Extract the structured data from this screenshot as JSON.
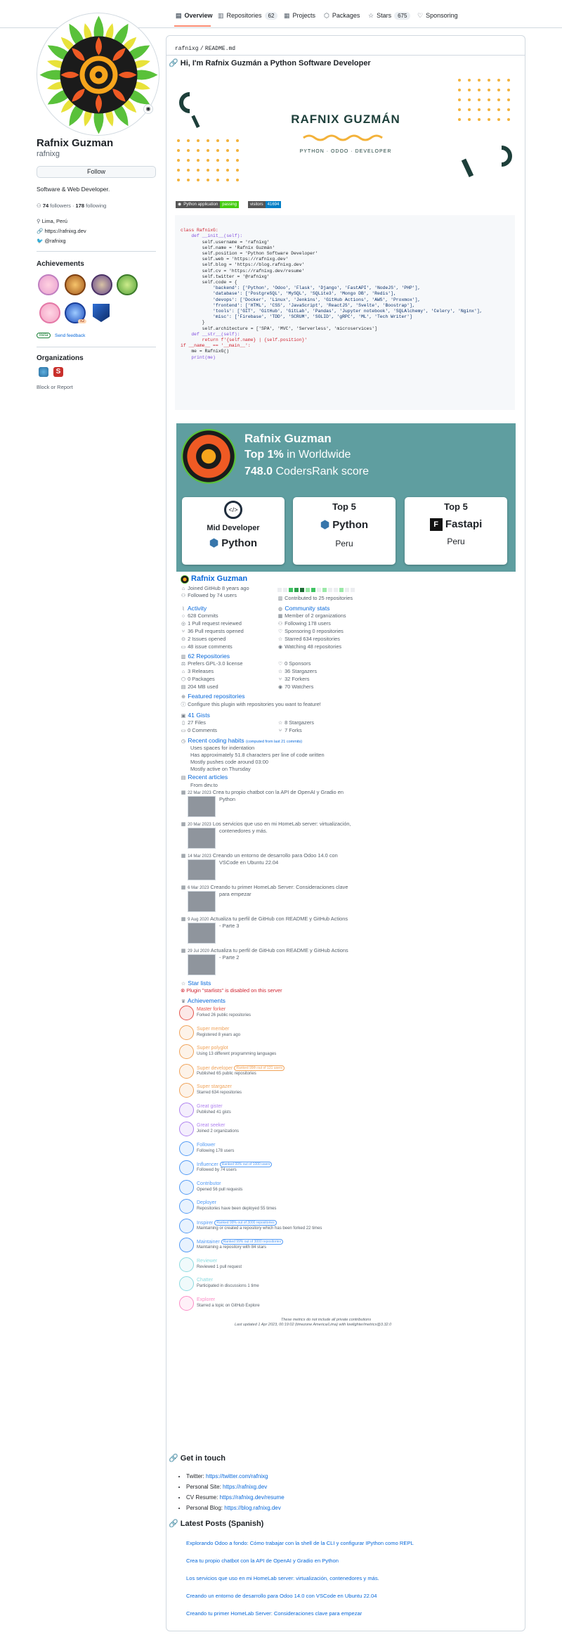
{
  "nav": {
    "tabs": [
      {
        "label": "Overview"
      },
      {
        "label": "Repositories",
        "count": "62"
      },
      {
        "label": "Projects"
      },
      {
        "label": "Packages"
      },
      {
        "label": "Stars",
        "count": "675"
      },
      {
        "label": "Sponsoring"
      }
    ]
  },
  "profile": {
    "name": "Rafnix Guzman",
    "username": "rafnixg",
    "follow_label": "Follow",
    "bio": "Software & Web Developer.",
    "followers_count": "74",
    "followers_label": "followers",
    "separator": "·",
    "following_count": "178",
    "following_label": "following",
    "location": "Lima, Perú",
    "website": "https://rafnixg.dev",
    "twitter": "@rafnixg",
    "achievements_title": "Achievements",
    "beta_label": "Beta",
    "feedback_label": "Send feedback",
    "achievement_count": "x2",
    "orgs_title": "Organizations",
    "block_label": "Block or Report"
  },
  "readme": {
    "path_user": "rafnixg",
    "path_sep": "/",
    "path_file": "README.md",
    "heading": "Hi, I'm Rafnix Guzmán a Python Software Developer",
    "banner_title": "RAFNIX GUZMÁN",
    "banner_subtitle": "PYTHON · ODOO · DEVELOPER",
    "badge1_left": "Python application",
    "badge1_right": "passing",
    "badge2_left": "visitors",
    "badge2_right": "41694",
    "code_lines": [
      "class RafnixG:",
      "",
      "    def __init__(self):",
      "        self.username = 'rafnixg'",
      "        self.name = 'Rafnix Guzmán'",
      "        self.position = 'Python Software Developer'",
      "        self.web = 'https://rafnixg.dev'",
      "        self.blog = 'https://blog.rafnixg.dev'",
      "        self.cv = 'https://rafnixg.dev/resume'",
      "        self.twitter = '@rafnixg'",
      "        self.code = {",
      "            'backend': ['Python', 'Odoo', 'Flask', 'Django', 'FastAPI', 'NodeJS', 'PHP'],",
      "            'database': ['PostgreSQL', 'MySQL', 'SQLite3', 'Mongo DB', 'Redis'],",
      "            'devops': ['Docker', 'Linux', 'Jenkins', 'GitHub Actions', 'AWS', 'Proxmox'],",
      "            'frontend': ['HTML', 'CSS', 'JavaScript', 'ReactJS', 'Svelte', 'Boostrap'],",
      "            'tools': ['GIT', 'GitHub', 'GitLab', 'Pandas', 'Jupyter notebook', 'SQLAlchemy', 'Celery', 'Nginx'],",
      "            'misc': ['Firebase', 'TDD', 'SCRUM', 'SOLID', 'gRPC', 'ML', 'Tech Writer']",
      "        }",
      "        self.architecture = ['SPA', 'MVC', 'Serverless', 'microservices']",
      "",
      "",
      "    def __str__(self):",
      "        return f'{self.name} | {self.position}'",
      "",
      "",
      "if __name__ == '__main__':",
      "    me = RafnixG()",
      "    print(me)"
    ],
    "coders_rank": {
      "name": "Rafnix Guzman",
      "top_pct": "Top 1%",
      "top_suffix": "in Worldwide",
      "score": "748.0",
      "score_suffix": "CodersRank score",
      "cards": [
        {
          "label": "Mid Developer",
          "sub": "Python"
        },
        {
          "label": "Top 5",
          "sub": "Python",
          "footer": "Peru"
        },
        {
          "label": "Top 5",
          "sub": "Fastapi",
          "footer": "Peru"
        }
      ]
    },
    "metrics": {
      "name": "Rafnix Guzman",
      "joined": "Joined GitHub 8 years ago",
      "followed": "Followed by 74 users",
      "contributed": "Contributed to 25 repositories",
      "activity_title": "Activity",
      "activity": [
        "628 Commits",
        "1 Pull request reviewed",
        "36 Pull requests opened",
        "2 Issues opened",
        "48 issue comments"
      ],
      "community_title": "Community stats",
      "community": [
        "Member of 2 organizations",
        "Following 178 users",
        "Sponsoring 0 repositories",
        "Starred 634 repositories",
        "Watching 48 repositories"
      ],
      "repos_title": "62 Repositories",
      "repos_left": [
        "Prefers GPL-3.0 license",
        "3 Releases",
        "0 Packages",
        "204 MB used"
      ],
      "repos_right": [
        "0 Sponsors",
        "36 Stargazers",
        "32 Forkers",
        "70 Watchers"
      ],
      "featured_title": "Featured repositories",
      "featured_text": "Configure this plugin with repositories you want to feature!",
      "gists_title": "41 Gists",
      "gists_left": [
        "27 Files",
        "0 Comments"
      ],
      "gists_right": [
        "8 Stargazers",
        "7 Forks"
      ],
      "habits_title": "Recent coding habits",
      "habits_note": "(computed from last 21 commits)",
      "habits": [
        "Uses spaces for indentation",
        "Has approximately 51.8 characters per line of code written",
        "Mostly pushes code around 03:00",
        "Mostly active on Thursday"
      ],
      "articles_title": "Recent articles",
      "articles_from": "From dev.to",
      "articles": [
        {
          "date": "22 Mar 2023",
          "title": "Crea tu propio chatbot con la API de OpenAI y Gradio en",
          "title2": "Python"
        },
        {
          "date": "20 Mar 2023",
          "title": "Los servicios que uso en mi HomeLab server: virtualización,",
          "title2": "contenedores y más."
        },
        {
          "date": "14 Mar 2023",
          "title": "Creando un entorno de desarrollo para Odoo 14.0 con",
          "title2": "VSCode en Ubuntu 22.04"
        },
        {
          "date": "6 Mar 2023",
          "title": "Creando tu primer HomeLab Server: Consideraciones clave",
          "title2": "para empezar"
        },
        {
          "date": "9 Aug 2020",
          "title": "Actualiza tu perfil de GitHub con README y GitHub Actions",
          "title2": "- Parte 3"
        },
        {
          "date": "29 Jul 2020",
          "title": "Actualiza tu perfil de GitHub con README y GitHub Actions",
          "title2": "- Parte 2"
        }
      ],
      "star_title": "Star lists",
      "star_error": "Plugin \"starlists\" is disabled on this server",
      "ach_title": "Achievements",
      "achievements": [
        {
          "title": "Master forker",
          "desc": "Forked 26 public repositories",
          "color": "#e5534b"
        },
        {
          "title": "Super member",
          "desc": "Registered 8 years ago",
          "color": "#f0a35a"
        },
        {
          "title": "Super polyglot",
          "desc": "Using 13 different programming languages",
          "color": "#f0a35a"
        },
        {
          "title": "Super developer",
          "pill": "Ranked 99th out of 131 users",
          "desc": "Published 65 public repositories",
          "color": "#f0a35a"
        },
        {
          "title": "Super stargazer",
          "desc": "Starred 634 repositories",
          "color": "#f0a35a"
        },
        {
          "title": "Great gister",
          "desc": "Published 41 gists",
          "color": "#b083f0"
        },
        {
          "title": "Great seeker",
          "desc": "Joined 2 organizations",
          "color": "#b083f0"
        },
        {
          "title": "Follower",
          "desc": "Following 178 users",
          "color": "#539bf5"
        },
        {
          "title": "Influencer",
          "pill": "Ranked 99% out of 1000 users",
          "desc": "Followed by 74 users",
          "color": "#539bf5"
        },
        {
          "title": "Contributor",
          "desc": "Opened 56 pull requests",
          "color": "#539bf5"
        },
        {
          "title": "Deployer",
          "desc": "Repositories have been deployed 55 times",
          "color": "#539bf5"
        },
        {
          "title": "Inspirer",
          "pill": "Ranked 99% out of 3000 repositories",
          "desc": "Maintaining or created a repository which has been forked 22 times",
          "color": "#539bf5"
        },
        {
          "title": "Maintainer",
          "pill": "Ranked 99% out of 3000 repositories",
          "desc": "Maintaining a repository with 84 stars",
          "color": "#539bf5"
        },
        {
          "title": "Reviewer",
          "desc": "Reviewed 1 pull request",
          "color": "#8ddbe0"
        },
        {
          "title": "Chatter",
          "desc": "Participated in discussions 1 time",
          "color": "#8ddbe0"
        },
        {
          "title": "Explorer",
          "desc": "Starred a topic on GitHub Explore",
          "color": "#fc8dc7"
        }
      ],
      "footer1": "These metrics do not include all private contributions",
      "footer2": "Last updated 1 Apr 2023, 00:19:02 (timezone America/Lima) with lowlighter/metrics@3.32.0"
    },
    "contact_title": "Get in touch",
    "contact": [
      {
        "label": "Twitter:",
        "value": "https://twitter.com/rafnixg"
      },
      {
        "label": "Personal Site:",
        "value": "https://rafnixg.dev"
      },
      {
        "label": "CV Resume:",
        "value": "https://rafnixg.dev/resume"
      },
      {
        "label": "Personal Blog:",
        "value": "https://blog.rafnixg.dev"
      }
    ],
    "posts_title": "Latest Posts (Spanish)",
    "posts": [
      "Explorando Odoo a fondo: Cómo trabajar con la shell de la CLI y configurar IPython como REPL",
      "Crea tu propio chatbot con la API de OpenAI y Gradio en Python",
      "Los servicios que uso en mi HomeLab server: virtualización, contenedores y más.",
      "Creando un entorno de desarrollo para Odoo 14.0 con VSCode en Ubuntu 22.04",
      "Creando tu primer HomeLab Server: Consideraciones clave para empezar"
    ]
  }
}
